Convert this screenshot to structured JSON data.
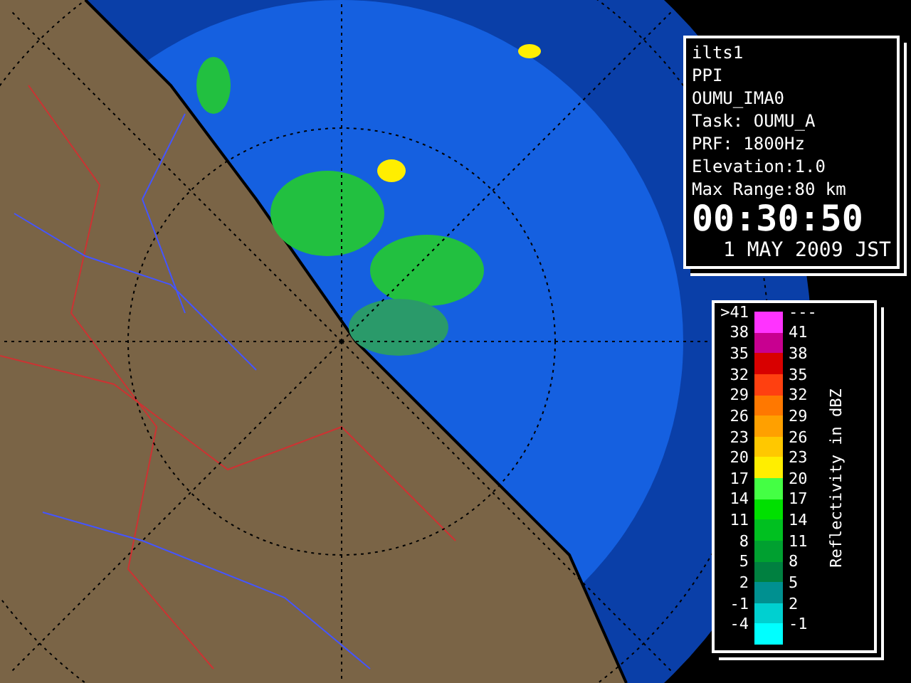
{
  "info_panel": {
    "lines": [
      "ilts1",
      "PPI",
      "OUMU_IMA0",
      "Task: OUMU_A",
      "PRF: 1800Hz",
      "Elevation:1.0",
      "Max Range:80 km"
    ],
    "time": "00:30:50",
    "date": "1 MAY 2009 JST"
  },
  "legend": {
    "title": "Reflectivity in dBZ",
    "rows": [
      {
        "upper": ">41",
        "lower": "---",
        "color": "#ff33ff"
      },
      {
        "upper": "38",
        "lower": "41",
        "color": "#c80090"
      },
      {
        "upper": "35",
        "lower": "38",
        "color": "#d80000"
      },
      {
        "upper": "32",
        "lower": "35",
        "color": "#ff4010"
      },
      {
        "upper": "29",
        "lower": "32",
        "color": "#ff7800"
      },
      {
        "upper": "26",
        "lower": "29",
        "color": "#ffa000"
      },
      {
        "upper": "23",
        "lower": "26",
        "color": "#ffc800"
      },
      {
        "upper": "20",
        "lower": "23",
        "color": "#ffee00"
      },
      {
        "upper": "17",
        "lower": "20",
        "color": "#44ff44"
      },
      {
        "upper": "14",
        "lower": "17",
        "color": "#00e000"
      },
      {
        "upper": "11",
        "lower": "14",
        "color": "#00c020"
      },
      {
        "upper": "8",
        "lower": "11",
        "color": "#00a030"
      },
      {
        "upper": "5",
        "lower": "8",
        "color": "#008040"
      },
      {
        "upper": "2",
        "lower": "5",
        "color": "#009090"
      },
      {
        "upper": "-1",
        "lower": "2",
        "color": "#00d0d0"
      },
      {
        "upper": "-4",
        "lower": "-1",
        "color": "#00ffff"
      }
    ]
  }
}
